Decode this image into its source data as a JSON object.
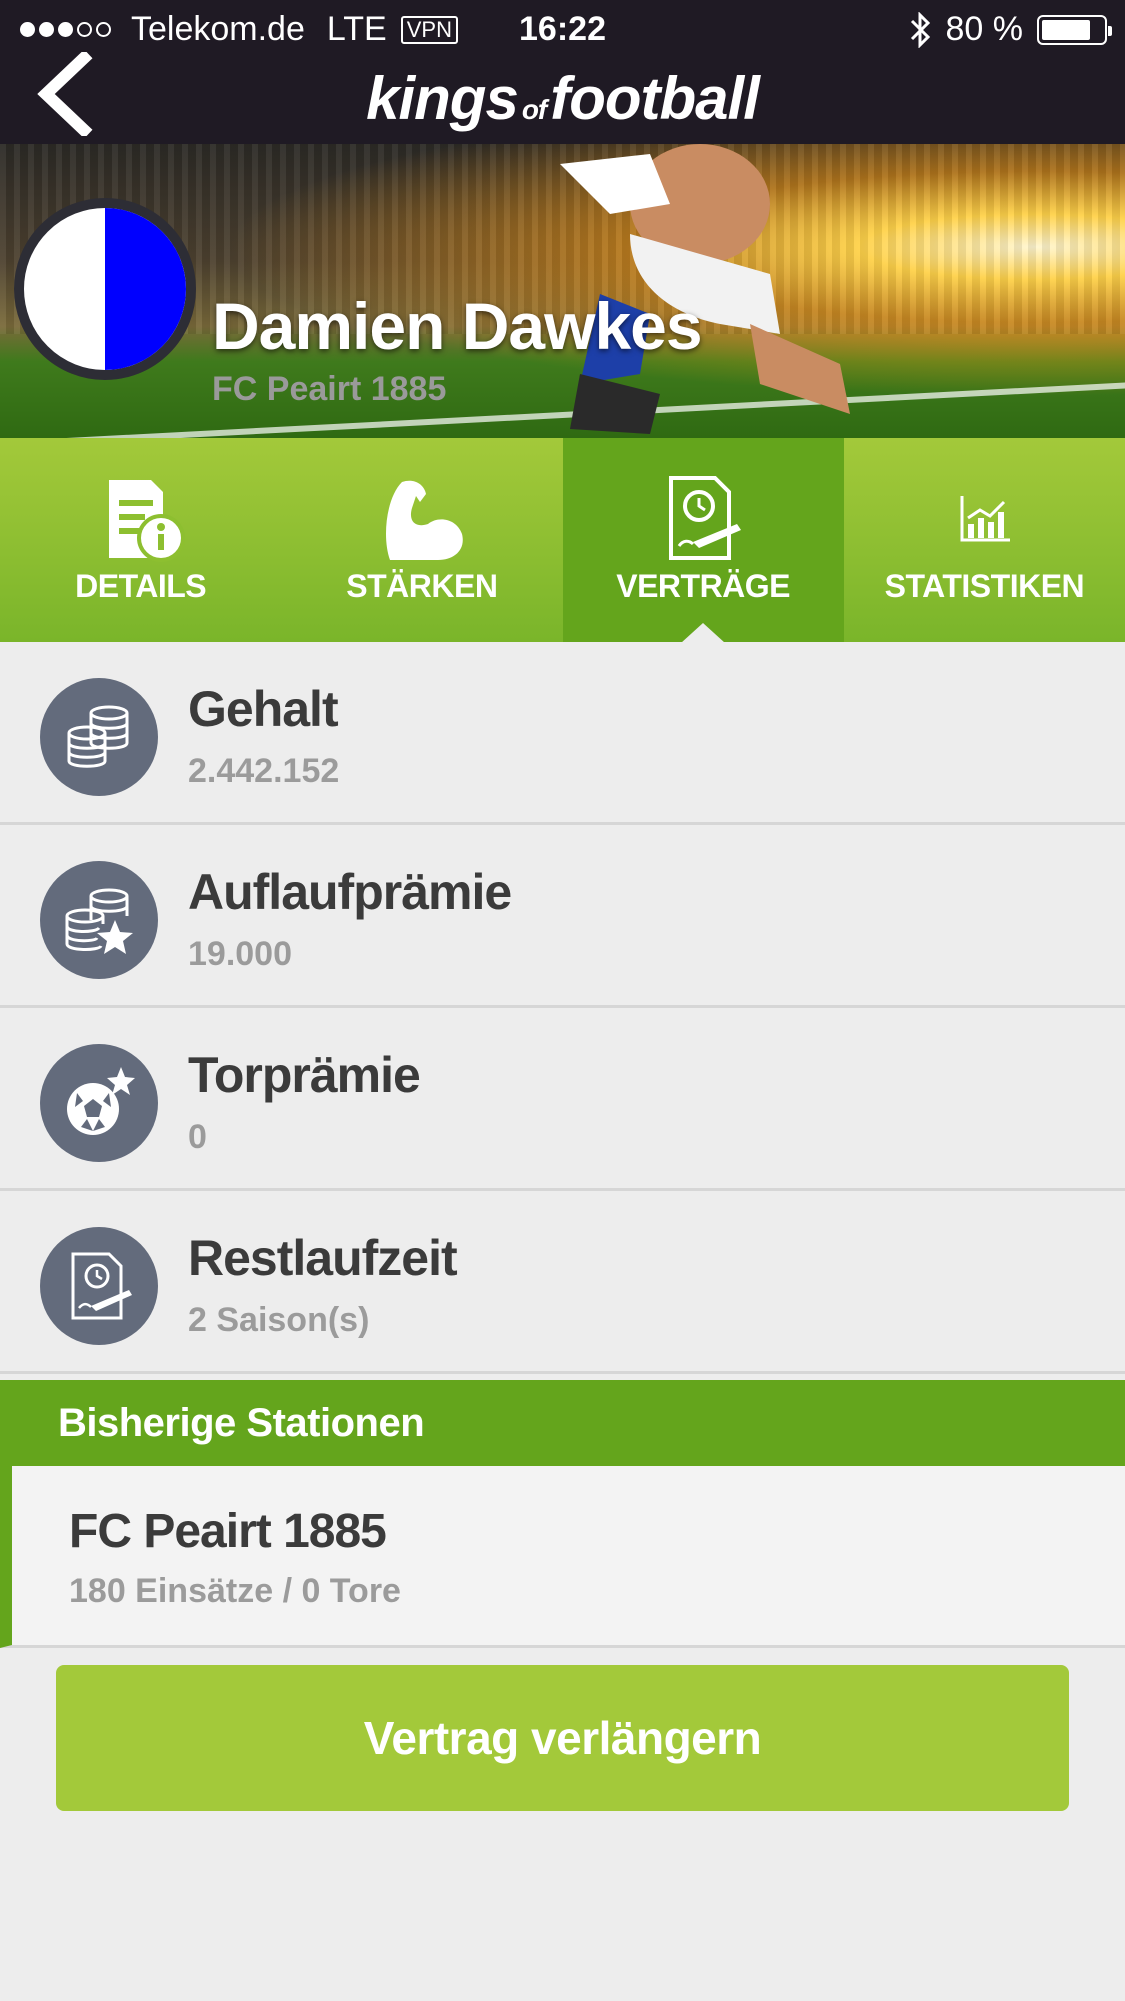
{
  "status_bar": {
    "carrier": "Telekom.de",
    "network": "LTE",
    "vpn": "VPN",
    "time": "16:22",
    "battery": "80 %",
    "battery_level": 0.8
  },
  "header": {
    "logo_kings": "kings",
    "logo_of": "of",
    "logo_football": "football"
  },
  "player": {
    "name": "Damien Dawkes",
    "club": "FC Peairt 1885",
    "badge_colors": [
      "#ffffff",
      "#0000ff"
    ]
  },
  "tabs": [
    {
      "label": "DETAILS",
      "icon": "document-info-icon",
      "active": false
    },
    {
      "label": "STÄRKEN",
      "icon": "muscle-arm-icon",
      "active": false
    },
    {
      "label": "VERTRÄGE",
      "icon": "contract-clock-icon",
      "active": true
    },
    {
      "label": "STATISTIKEN",
      "icon": "bar-chart-icon",
      "active": false
    }
  ],
  "contract": [
    {
      "title": "Gehalt",
      "value": "2.442.152",
      "icon": "coins-icon"
    },
    {
      "title": "Auflaufprämie",
      "value": "19.000",
      "icon": "coins-star-icon"
    },
    {
      "title": "Torprämie",
      "value": "0",
      "icon": "football-star-icon"
    },
    {
      "title": "Restlaufzeit",
      "value": "2 Saison(s)",
      "icon": "contract-clock-icon"
    }
  ],
  "stations": {
    "header": "Bisherige Stationen",
    "items": [
      {
        "club": "FC Peairt 1885",
        "stats": "180 Einsätze / 0 Tore"
      }
    ]
  },
  "actions": {
    "extend_label": "Vertrag verlängern"
  },
  "colors": {
    "navbar": "#1f1a24",
    "green_light": "#a3c93a",
    "green_dark": "#64a51c",
    "icon_circle": "#636b7c"
  }
}
